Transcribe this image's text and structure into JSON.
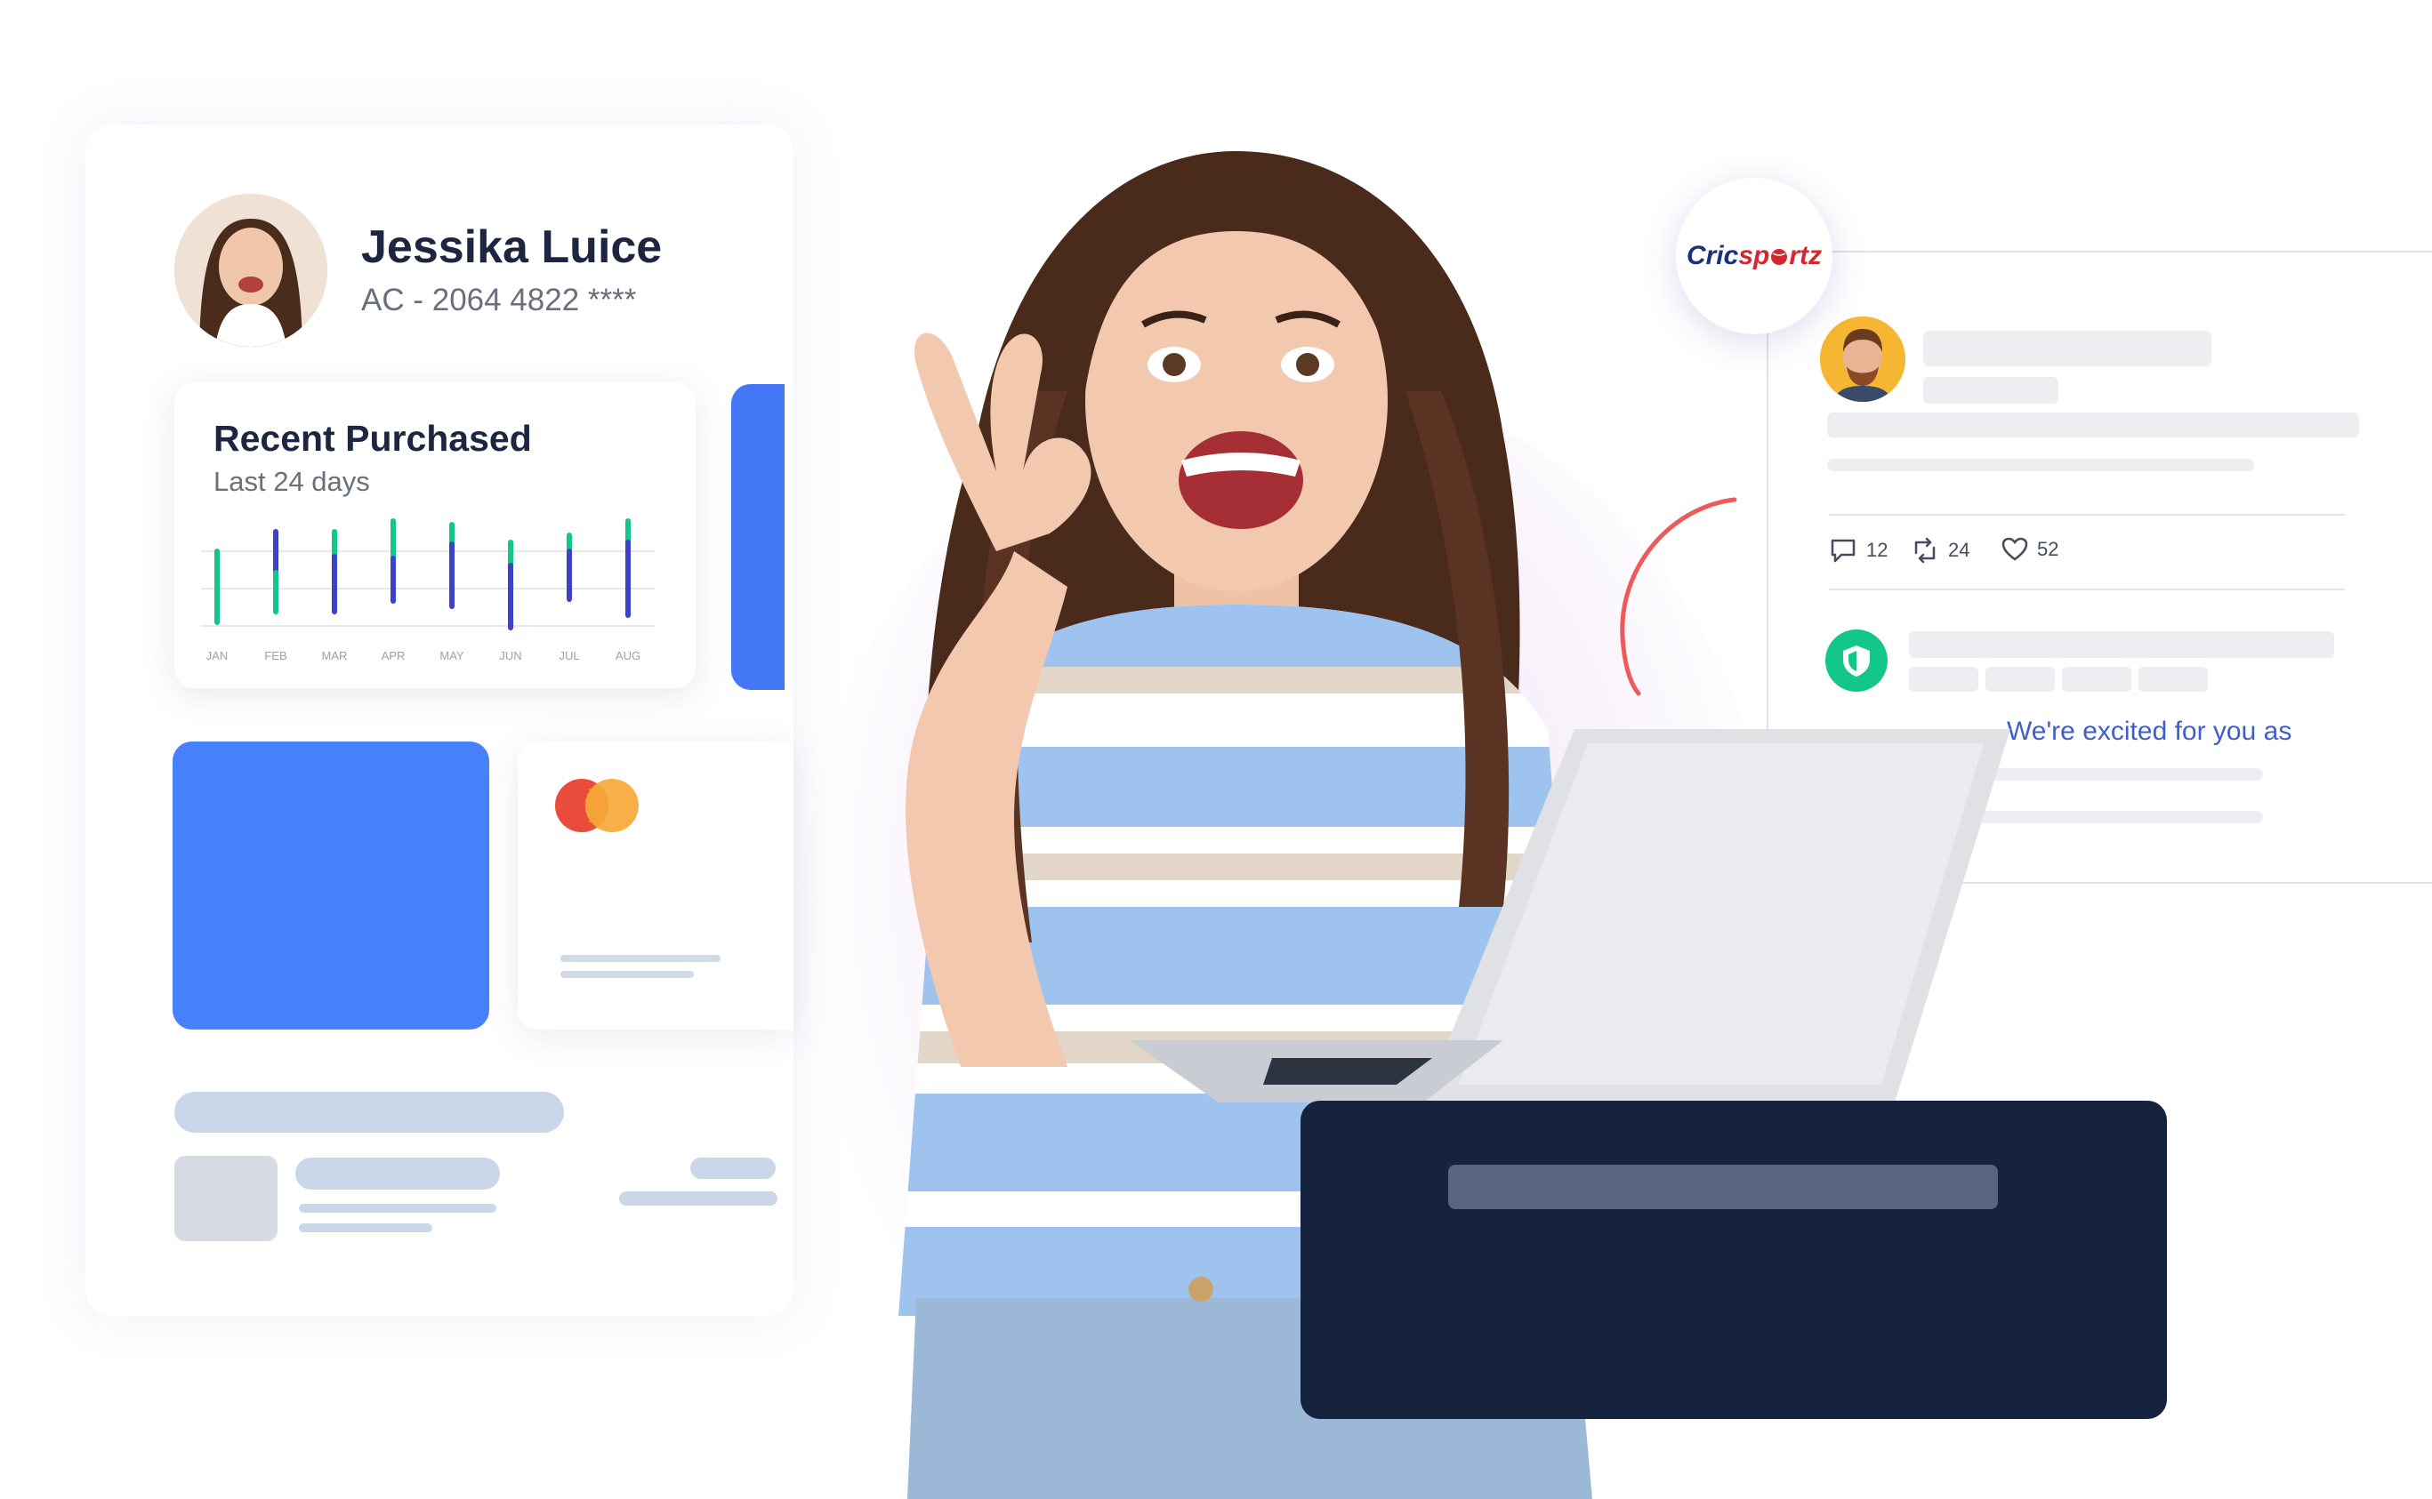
{
  "profile": {
    "name": "Jessika Luice",
    "account": "AC - 2064 4822 ****"
  },
  "recent_purchased": {
    "title": "Recent Purchased",
    "subtitle": "Last 24 days",
    "months": [
      "JAN",
      "FEB",
      "MAR",
      "APR",
      "MAY",
      "JUN",
      "JUL",
      "AUG"
    ]
  },
  "post": {
    "brand": {
      "part1": "Cric",
      "part2": "sp",
      "part3": "rtz"
    },
    "comments": "12",
    "reposts": "24",
    "likes": "52",
    "message": "We're excited for you as"
  },
  "colors": {
    "accent_blue": "#4680fb",
    "chart_green": "#12c78b",
    "chart_indigo": "#3d43c8",
    "dark_navy": "#16233f",
    "arc_red": "#ee5a5a"
  }
}
